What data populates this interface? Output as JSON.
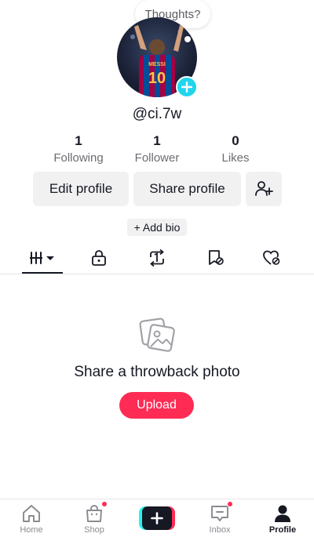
{
  "profile": {
    "thought_bubble": "Thoughts?",
    "username": "@ci.7w",
    "avatar_jersey_name": "MESSI",
    "avatar_jersey_number": "10"
  },
  "stats": [
    {
      "value": "1",
      "label": "Following"
    },
    {
      "value": "1",
      "label": "Follower"
    },
    {
      "value": "0",
      "label": "Likes"
    }
  ],
  "actions": {
    "edit_profile": "Edit profile",
    "share_profile": "Share profile",
    "add_bio": "+ Add bio"
  },
  "tabs": [
    {
      "icon": "grid-videos-icon",
      "active": true
    },
    {
      "icon": "lock-icon",
      "active": false
    },
    {
      "icon": "repost-icon",
      "active": false
    },
    {
      "icon": "favorites-bookmark-icon",
      "active": false
    },
    {
      "icon": "liked-heart-icon",
      "active": false
    }
  ],
  "empty_state": {
    "icon": "photos-icon",
    "title": "Share a throwback photo",
    "button": "Upload"
  },
  "bottom_nav": [
    {
      "label": "Home",
      "icon": "home-icon",
      "active": false,
      "dot": false
    },
    {
      "label": "Shop",
      "icon": "shop-bag-icon",
      "active": false,
      "dot": true
    },
    {
      "label": "",
      "icon": "create-plus-icon",
      "active": false,
      "dot": false
    },
    {
      "label": "Inbox",
      "icon": "inbox-icon",
      "active": false,
      "dot": true
    },
    {
      "label": "Profile",
      "icon": "profile-icon",
      "active": true,
      "dot": false
    }
  ],
  "colors": {
    "accent_red": "#fe2c55",
    "accent_cyan": "#25f4ee",
    "badge_blue": "#20d5ec",
    "text_primary": "#161823"
  }
}
